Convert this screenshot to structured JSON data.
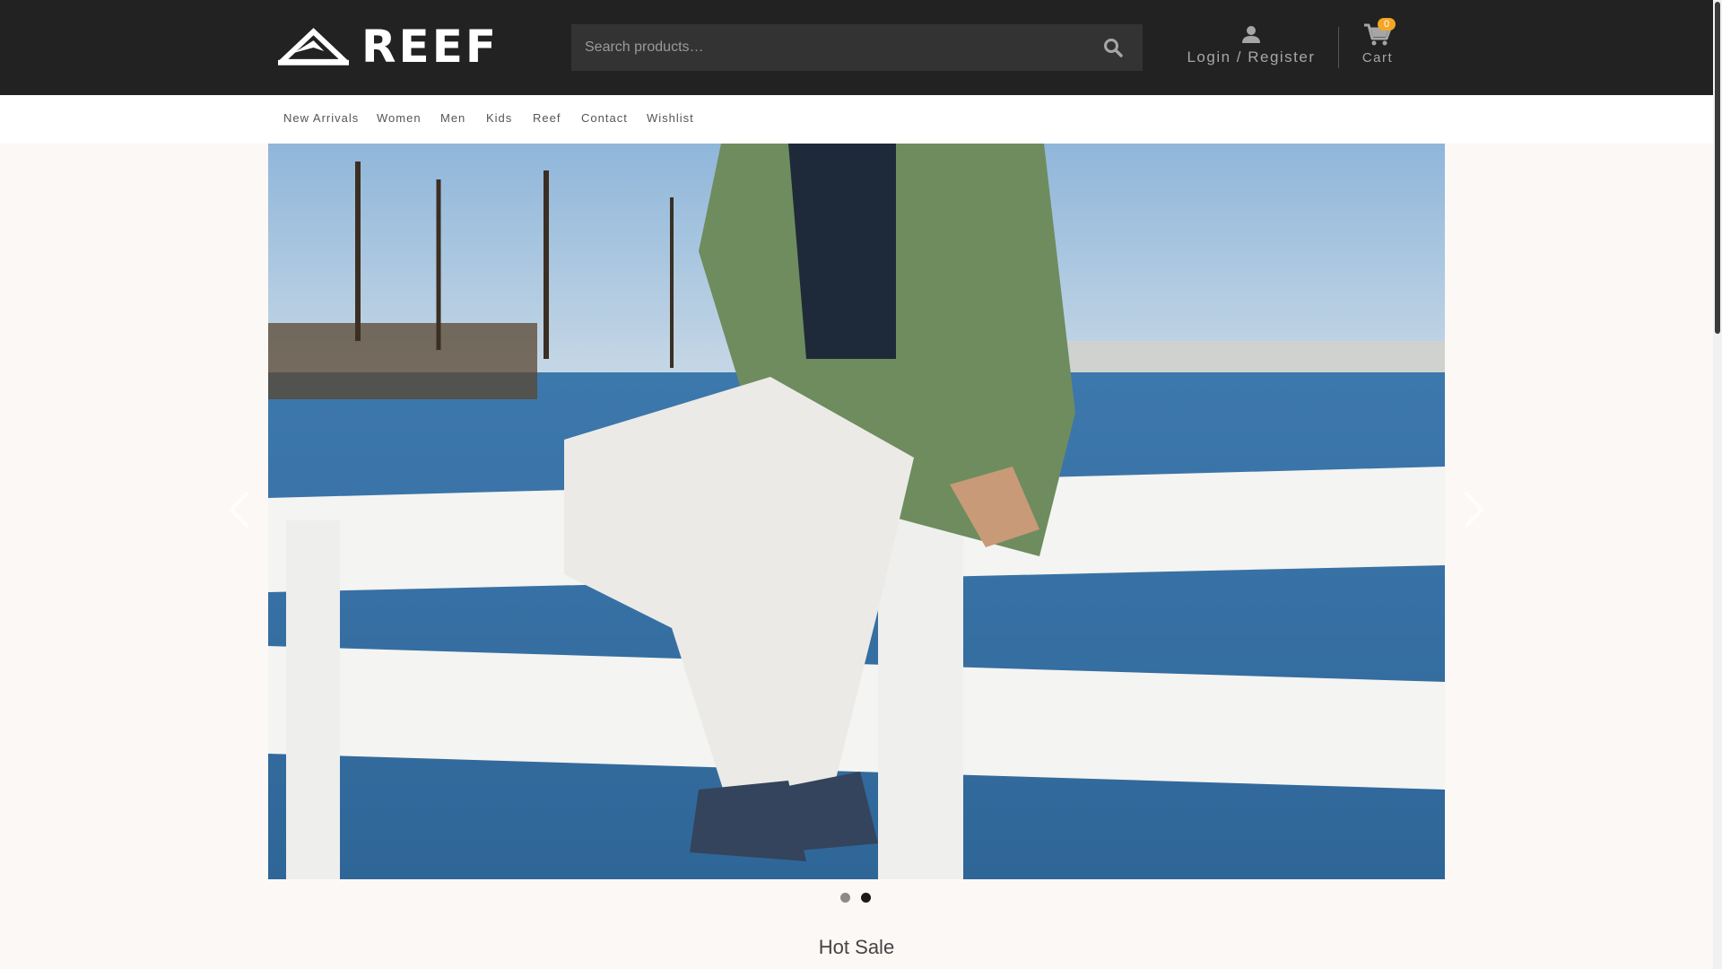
{
  "brand": {
    "name": "REEF"
  },
  "search": {
    "placeholder": "Search products…"
  },
  "account": {
    "label": "Login / Register",
    "icon": "user-icon"
  },
  "cart": {
    "label": "Cart",
    "count": "0",
    "icon": "cart-icon"
  },
  "nav": {
    "items": [
      {
        "label": "New Arrivals"
      },
      {
        "label": "Women"
      },
      {
        "label": "Men"
      },
      {
        "label": "Kids"
      },
      {
        "label": "Reef"
      },
      {
        "label": "Contact"
      },
      {
        "label": "Wishlist"
      }
    ]
  },
  "slider": {
    "active_slide": 2,
    "slide_count": 2,
    "image": "man in green shirt and white pants sitting on white pier railing wearing navy boat shoes, sailing ships and bay behind"
  },
  "sections": {
    "hot_sale_title": "Hot Sale"
  },
  "colors": {
    "header_bg": "#222222",
    "search_bg": "#333333",
    "badge": "#f5a623",
    "page_bg": "#fcf8f6"
  }
}
